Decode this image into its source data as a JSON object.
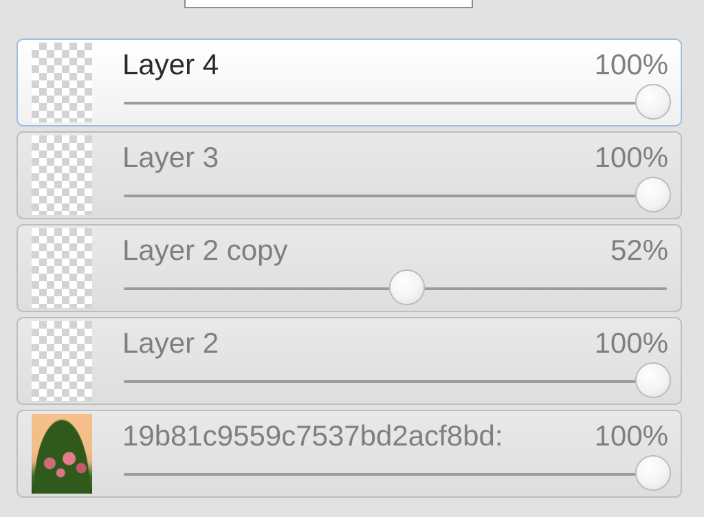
{
  "layers_panel": {
    "layers": [
      {
        "name": "Layer 4",
        "opacity_label": "100%",
        "opacity": 1.0,
        "selected": true,
        "thumbnail": "transparent"
      },
      {
        "name": "Layer 3",
        "opacity_label": "100%",
        "opacity": 1.0,
        "selected": false,
        "thumbnail": "transparent"
      },
      {
        "name": "Layer 2 copy",
        "opacity_label": "52%",
        "opacity": 0.52,
        "selected": false,
        "thumbnail": "transparent"
      },
      {
        "name": "Layer 2",
        "opacity_label": "100%",
        "opacity": 1.0,
        "selected": false,
        "thumbnail": "transparent"
      },
      {
        "name": "19b81c9559c7537bd2acf8bd:",
        "opacity_label": "100%",
        "opacity": 1.0,
        "selected": false,
        "thumbnail": "photo-flowers"
      }
    ],
    "colors": {
      "selected_border": "#9fbce3",
      "panel_background": "#e2e2e2"
    }
  }
}
